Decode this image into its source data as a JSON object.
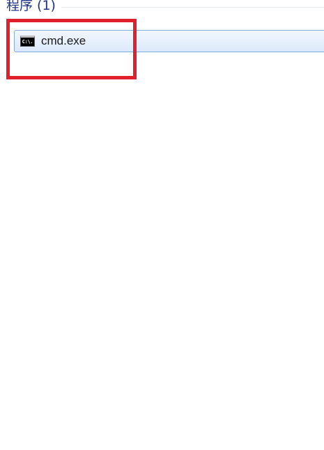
{
  "group": {
    "title": "程序 (1)"
  },
  "results": [
    {
      "label": "cmd.exe",
      "icon": "command-prompt-icon",
      "icon_text": "C:\\."
    }
  ],
  "annotation": {
    "color": "#e0202c"
  },
  "colors": {
    "header_text": "#1e3287",
    "selection_border": "#84acdd",
    "selection_fill": "#dce9fb"
  }
}
